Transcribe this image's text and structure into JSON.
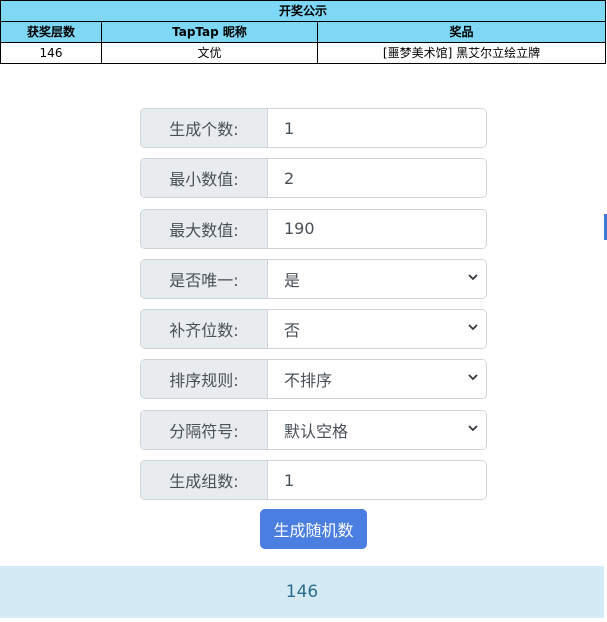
{
  "table": {
    "title": "开奖公示",
    "headers": [
      "获奖层数",
      "TapTap 昵称",
      "奖品"
    ],
    "rows": [
      [
        "146",
        "文优",
        "[噩梦美术馆] 黑艾尔立绘立牌"
      ]
    ]
  },
  "form": {
    "fields": [
      {
        "label": "生成个数:",
        "value": "1",
        "type": "input"
      },
      {
        "label": "最小数值:",
        "value": "2",
        "type": "input"
      },
      {
        "label": "最大数值:",
        "value": "190",
        "type": "input"
      },
      {
        "label": "是否唯一:",
        "value": "是",
        "type": "select"
      },
      {
        "label": "补齐位数:",
        "value": "否",
        "type": "select"
      },
      {
        "label": "排序规则:",
        "value": "不排序",
        "type": "select"
      },
      {
        "label": "分隔符号:",
        "value": "默认空格",
        "type": "select"
      },
      {
        "label": "生成组数:",
        "value": "1",
        "type": "input"
      }
    ],
    "button_label": "生成随机数"
  },
  "result": {
    "value": "146"
  },
  "colors": {
    "table_header": "#7fd7f6",
    "button": "#4a7ee0",
    "result_bg": "#d4ebf6",
    "result_text": "#2b6e8c"
  }
}
